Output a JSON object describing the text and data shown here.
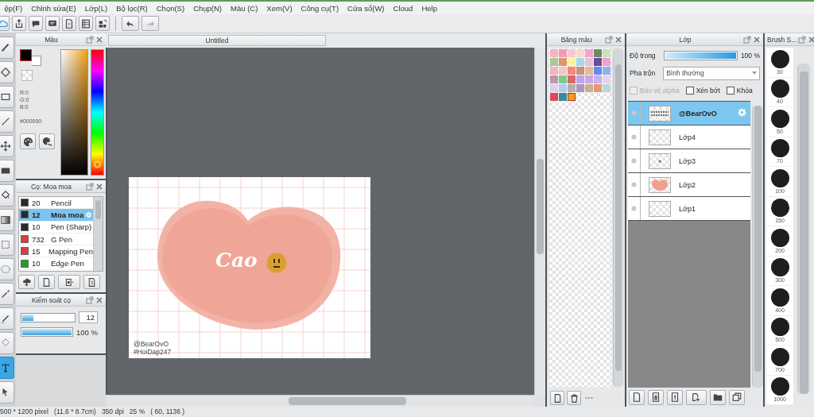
{
  "menu": [
    "ệp(F)",
    "Chỉnh sửa(E)",
    "Lớp(L)",
    "Bộ lọc(R)",
    "Chọn(S)",
    "Chụp(N)",
    "Màu (C)",
    "Xem(V)",
    "Công cụ(T)",
    "Cửa sổ(W)",
    "Cloud",
    "Help"
  ],
  "toolbar": [
    {
      "kind": "cloud",
      "disabled": false
    },
    {
      "kind": "share",
      "disabled": false
    },
    {
      "kind": "comment",
      "disabled": false
    },
    {
      "kind": "message",
      "disabled": false
    },
    {
      "kind": "page",
      "disabled": false
    },
    {
      "kind": "list",
      "disabled": false
    },
    {
      "kind": "grid",
      "disabled": false
    },
    {
      "kind": "undo",
      "disabled": false
    },
    {
      "kind": "redo",
      "disabled": true
    }
  ],
  "tools": [
    {
      "kind": "brush",
      "selected": false
    },
    {
      "kind": "eraser",
      "selected": false
    },
    {
      "kind": "rect",
      "selected": false
    },
    {
      "kind": "pen",
      "selected": false
    },
    {
      "kind": "move",
      "selected": false
    },
    {
      "kind": "fill",
      "selected": false
    },
    {
      "kind": "bucket",
      "selected": false
    },
    {
      "kind": "gradient",
      "selected": false
    },
    {
      "kind": "select",
      "selected": false
    },
    {
      "kind": "lasso",
      "selected": false
    },
    {
      "kind": "wand",
      "selected": false
    },
    {
      "kind": "selectpen",
      "selected": false
    },
    {
      "kind": "selecteraser",
      "selected": false
    },
    {
      "kind": "text",
      "selected": true
    },
    {
      "kind": "operation",
      "selected": false
    }
  ],
  "color_panel": {
    "title": "Màu",
    "hue": {
      "level": 0.08
    },
    "r": "R:0",
    "g": "G:0",
    "b": "B:0",
    "hex": "#000000"
  },
  "brush_panel": {
    "title": "Cọ: Moa moa",
    "brushes": [
      {
        "size": "20",
        "name": "Pencil",
        "color": "#2a2a2a",
        "selected": false
      },
      {
        "size": "12",
        "name": "Moa moa",
        "color": "#2a2a2a",
        "selected": true
      },
      {
        "size": "10",
        "name": "Pen (Sharp)",
        "color": "#2a2a2a",
        "selected": false
      },
      {
        "size": "732",
        "name": "G Pen",
        "color": "#e03a3a",
        "selected": false
      },
      {
        "size": "15",
        "name": "Mapping Pen",
        "color": "#e03a3a",
        "selected": false
      },
      {
        "size": "10",
        "name": "Edge Pen",
        "color": "#22a022",
        "selected": false
      }
    ]
  },
  "brush_control": {
    "title": "Kiểm soát cọ",
    "size": {
      "level": 0.22,
      "value": "12"
    },
    "opacity": {
      "level": 1,
      "value": "100 %"
    }
  },
  "canvas": {
    "tab": "Untitled",
    "title_text": "Cao",
    "credit": "@BearOvO",
    "tag": "#HoiDap247"
  },
  "palette": {
    "title": "Bảng màu",
    "swatches": [
      {
        "color": "#f4b3c2",
        "selected": false
      },
      {
        "color": "#f19cb6",
        "selected": false
      },
      {
        "color": "#f6c8d6",
        "selected": false
      },
      {
        "color": "#fbd9c8",
        "selected": false
      },
      {
        "color": "#f4a3d8",
        "selected": false
      },
      {
        "color": "#6f8a5f",
        "selected": false
      },
      {
        "color": "#c9e3bd",
        "selected": false
      },
      {
        "color": "#a8c98f",
        "selected": false
      },
      {
        "color": "#e0956a",
        "selected": false
      },
      {
        "color": "#fbf59a",
        "selected": false
      },
      {
        "color": "#a9d8ee",
        "selected": false
      },
      {
        "color": "#e8c3d8",
        "selected": false
      },
      {
        "color": "#6a4a9a",
        "selected": false
      },
      {
        "color": "#f2a0d0",
        "selected": false
      },
      {
        "color": "#f2b5c5",
        "selected": false
      },
      {
        "color": "#f5c4c4",
        "selected": false
      },
      {
        "color": "#f08a7a",
        "selected": false
      },
      {
        "color": "#c9907a",
        "selected": false
      },
      {
        "color": "#e8b89a",
        "selected": false
      },
      {
        "color": "#5e8ef0",
        "selected": false
      },
      {
        "color": "#8fb0e8",
        "selected": false
      },
      {
        "color": "#b89aa8",
        "selected": false
      },
      {
        "color": "#7fc98a",
        "selected": false
      },
      {
        "color": "#d46a6a",
        "selected": false
      },
      {
        "color": "#b8a8e8",
        "selected": false
      },
      {
        "color": "#caa8e8",
        "selected": false
      },
      {
        "color": "#c9b0f0",
        "selected": false
      },
      {
        "color": "#e8d0f0",
        "selected": false
      },
      {
        "color": "#e0d0f0",
        "selected": false
      },
      {
        "color": "#b8c8f0",
        "selected": false
      },
      {
        "color": "#b8b0a8",
        "selected": false
      },
      {
        "color": "#a898c0",
        "selected": false
      },
      {
        "color": "#c8b090",
        "selected": false
      },
      {
        "color": "#e89878",
        "selected": false
      },
      {
        "color": "#b8d8d8",
        "selected": false
      },
      {
        "color": "#d84a5a",
        "selected": false
      },
      {
        "color": "#3a8aa0",
        "selected": false
      },
      {
        "color": "#e8a020",
        "selected": true
      }
    ]
  },
  "layers": {
    "title": "Lớp",
    "opacity_label": "Độ trong",
    "opacity": {
      "level": 1,
      "value": "100 %"
    },
    "blend_label": "Pha trộn",
    "blend": "Bình thường",
    "options": [
      {
        "label": "Bảo vệ alpha",
        "checked": false,
        "disabled": true
      },
      {
        "label": "Xén bớt",
        "checked": false,
        "disabled": false
      },
      {
        "label": "Khóa",
        "checked": false,
        "disabled": false
      }
    ],
    "items": [
      {
        "name": "@BearOvO",
        "kind": "text",
        "selected": true
      },
      {
        "name": "Lớp4",
        "kind": "empty",
        "selected": false
      },
      {
        "name": "Lớp3",
        "kind": "dot",
        "selected": false
      },
      {
        "name": "Lớp2",
        "kind": "heart",
        "selected": false
      },
      {
        "name": "Lớp1",
        "kind": "empty",
        "selected": false
      }
    ]
  },
  "brush_sizes": {
    "title": "Brush S...",
    "sizes": [
      "30",
      "40",
      "50",
      "70",
      "100",
      "150",
      "200",
      "300",
      "400",
      "500",
      "700",
      "1000"
    ]
  },
  "status_bar": "500 * 1200 pixel   (11.6 * 8.7cm)   350 dpi   25 %   ( 60, 1136 )"
}
